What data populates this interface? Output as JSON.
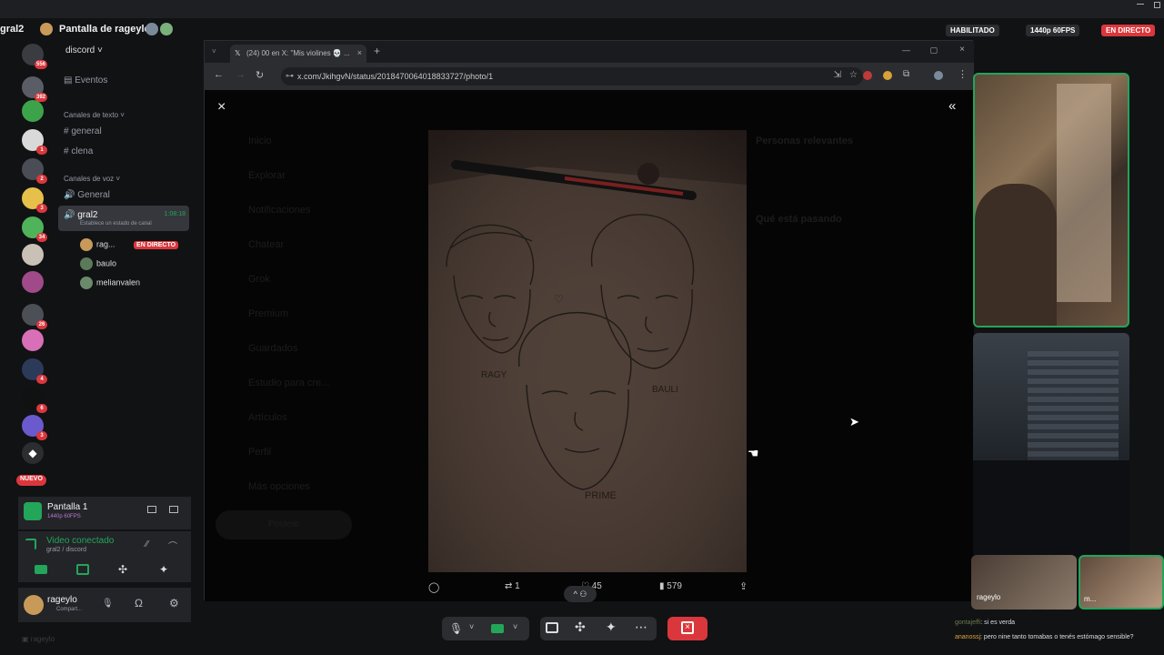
{
  "header": {
    "user_short": "gral2",
    "stream_title": "Pantalla de rageylo",
    "enabled_label": "HABILITADO",
    "quality": "1440p 60FPS",
    "live": "EN DIRECTO"
  },
  "rail": {
    "top_badge": "556",
    "badges": [
      "392",
      "1",
      "2",
      "3",
      "34",
      "26",
      "4",
      "6",
      "3"
    ],
    "new_label": "NUEVO"
  },
  "server": {
    "name": "discord",
    "events": "Eventos",
    "text_category": "Canales de texto",
    "text_channels": [
      "general",
      "clena"
    ],
    "voice_category": "Canales de voz",
    "voice_channels": [
      "General",
      "gral2"
    ],
    "active_timer": "1:08:18",
    "status_hint": "Establece un estado de canal",
    "voice_users": [
      {
        "name": "rag...",
        "live": "EN DIRECTO"
      },
      {
        "name": "baulo"
      },
      {
        "name": "melianvalen"
      }
    ]
  },
  "screen_panel": {
    "title": "Pantalla 1",
    "sub": "1440p 60FPS"
  },
  "voice_panel": {
    "title": "Video conectado",
    "sub": "gral2 / discord"
  },
  "user_panel": {
    "name": "rageylo",
    "status": "Compart..."
  },
  "browser": {
    "tab_title": "(24) 00 en X: \"Mis violines 💀 ...",
    "url": "x.com/JkihgvN/status/2018470064018833727/photo/1",
    "sidebar_items": [
      "Inicio",
      "Explorar",
      "Notificaciones",
      "Chatear",
      "Grok",
      "Premium",
      "Guardados",
      "Estudio para cre...",
      "Artículos",
      "Perfil",
      "Más opciones"
    ],
    "post_button": "Postear",
    "right_title": "Personas relevantes",
    "right_section": "Qué está pasando",
    "photo_labels": [
      "RAGY",
      "BAULI",
      "PRIME"
    ],
    "replies": "",
    "retweets": "1",
    "likes": "45",
    "views": "579"
  },
  "tiles": {
    "tile_a_name": "rageylo",
    "tile_b_name": "m..."
  },
  "chat": [
    {
      "user": "gontajeffi",
      "text": ": si es verda"
    },
    {
      "user": "ananossj",
      "text": ": pero nine tanto tomabas o tenés estómago sensible?"
    }
  ],
  "colors": {
    "accent_green": "#23a55a",
    "live_red": "#da373c",
    "end_call_red": "#da373c",
    "discord_bg": "#111214"
  }
}
